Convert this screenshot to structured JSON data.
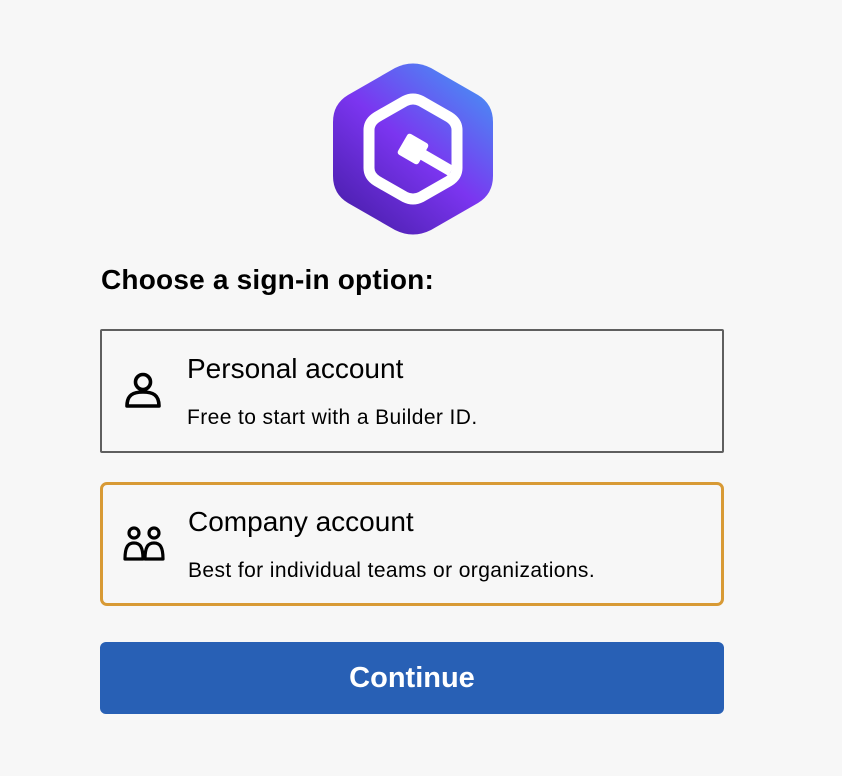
{
  "logo": {
    "icon": "q-hexagon-logo-icon",
    "gradient_start": "#3ea0f5",
    "gradient_mid": "#7b35f0",
    "gradient_end": "#4b1fae"
  },
  "heading": "Choose a sign-in option:",
  "options": [
    {
      "icon": "person-icon",
      "title": "Personal account",
      "description": "Free to start with a Builder ID.",
      "selected": false,
      "border_color": "#5f5f5f"
    },
    {
      "icon": "people-icon",
      "title": "Company account",
      "description": "Best for individual teams or organizations.",
      "selected": true,
      "border_color": "#d89a35"
    }
  ],
  "continue_label": "Continue",
  "colors": {
    "background": "#f7f7f7",
    "primary_button": "#2860b5",
    "selected_border": "#d89a35"
  }
}
